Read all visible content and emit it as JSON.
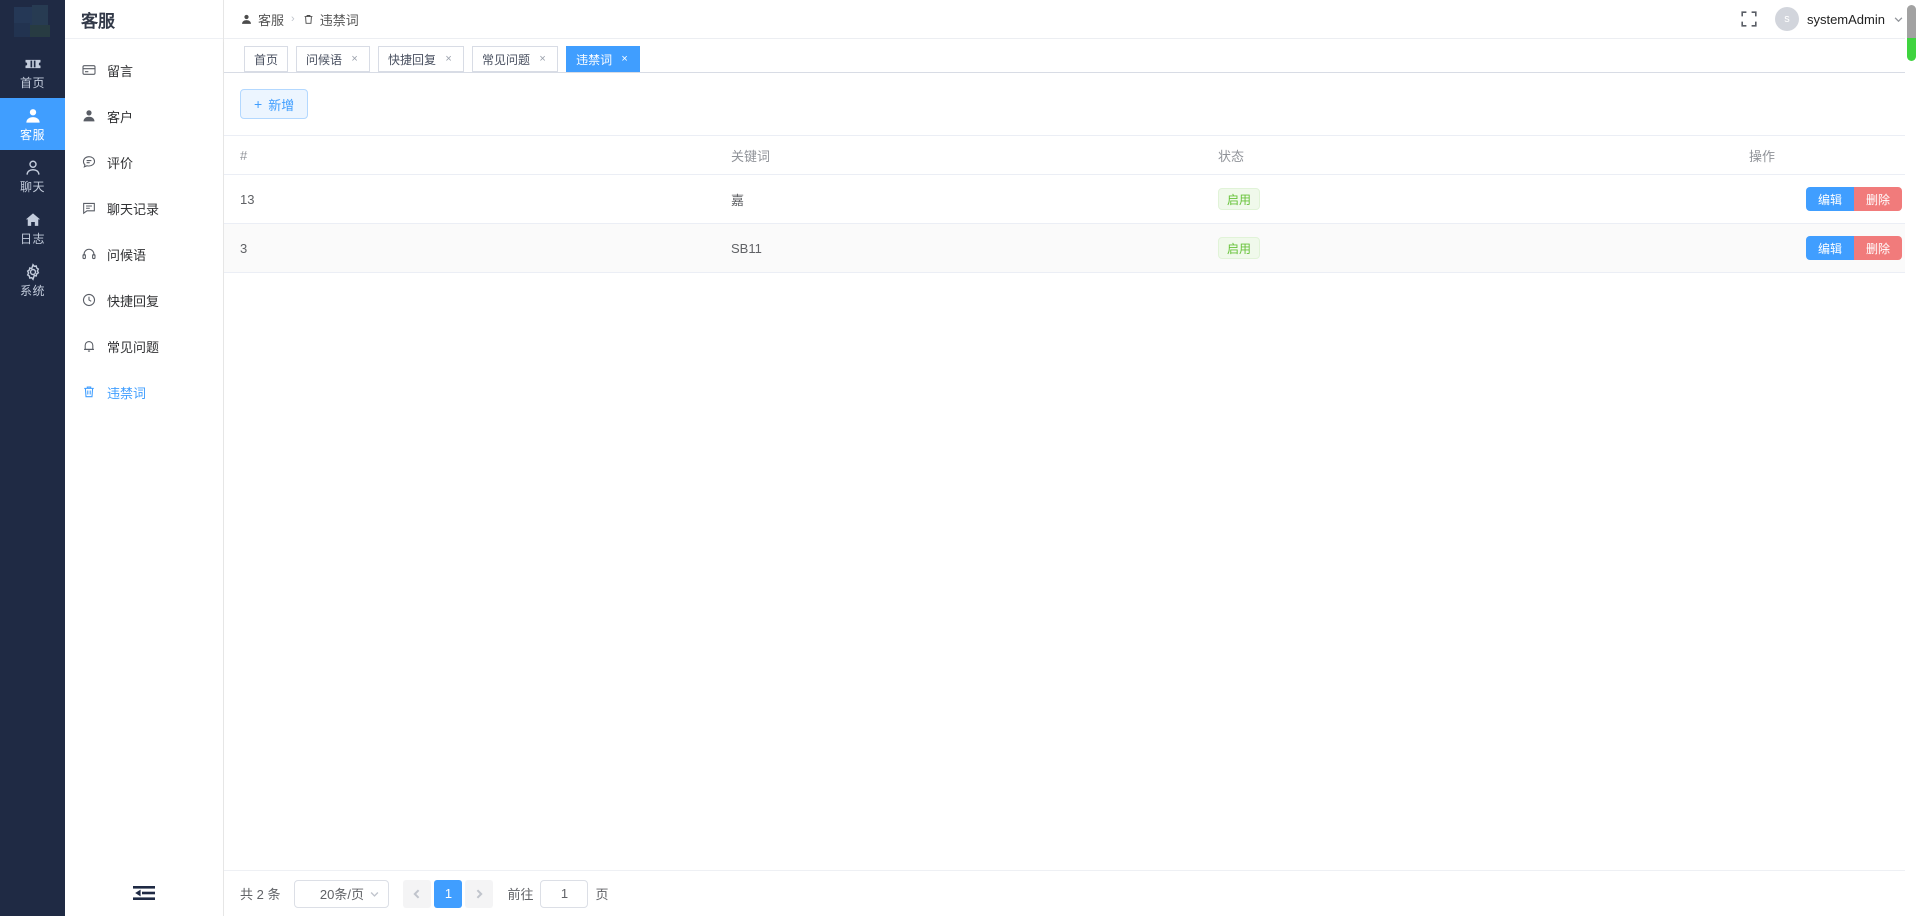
{
  "rail": {
    "logo_icon": "app-logo",
    "items": [
      {
        "label": "首页",
        "icon": "ticket-icon",
        "active": false
      },
      {
        "label": "客服",
        "icon": "user-solid-icon",
        "active": true
      },
      {
        "label": "聊天",
        "icon": "user-outline-icon",
        "active": false
      },
      {
        "label": "日志",
        "icon": "home-icon",
        "active": false
      },
      {
        "label": "系统",
        "icon": "gear-icon",
        "active": false
      }
    ]
  },
  "submenu": {
    "title": "客服",
    "items": [
      {
        "label": "留言",
        "icon": "card-icon",
        "active": false
      },
      {
        "label": "客户",
        "icon": "user-solid-icon",
        "active": false
      },
      {
        "label": "评价",
        "icon": "comment-dots-icon",
        "active": false
      },
      {
        "label": "聊天记录",
        "icon": "chat-lines-icon",
        "active": false
      },
      {
        "label": "问候语",
        "icon": "headset-icon",
        "active": false
      },
      {
        "label": "快捷回复",
        "icon": "clock-icon",
        "active": false
      },
      {
        "label": "常见问题",
        "icon": "bell-icon",
        "active": false
      },
      {
        "label": "违禁词",
        "icon": "trash-icon",
        "active": true
      }
    ],
    "collapse_icon": "hamburger-collapse-icon"
  },
  "navbar": {
    "breadcrumb": [
      {
        "label": "客服",
        "icon": "user-solid-icon"
      },
      {
        "label": "违禁词",
        "icon": "trash-icon"
      }
    ],
    "separator": "›",
    "fullscreen_icon": "fullscreen-icon",
    "user": {
      "avatar_initial": "s",
      "name": "systemAdmin",
      "caret_icon": "chevron-down-icon"
    }
  },
  "tags": [
    {
      "label": "首页",
      "closable": false,
      "active": false
    },
    {
      "label": "问候语",
      "closable": true,
      "active": false
    },
    {
      "label": "快捷回复",
      "closable": true,
      "active": false
    },
    {
      "label": "常见问题",
      "closable": true,
      "active": false
    },
    {
      "label": "违禁词",
      "closable": true,
      "active": true
    }
  ],
  "tag_close_glyph": "×",
  "toolbar": {
    "add_label": "新增",
    "add_plus": "+"
  },
  "table": {
    "columns": [
      {
        "key": "id",
        "label": "#"
      },
      {
        "key": "keyword",
        "label": "关键词"
      },
      {
        "key": "status",
        "label": "状态"
      },
      {
        "key": "ops",
        "label": "操作"
      }
    ],
    "rows": [
      {
        "id": "13",
        "keyword": "嘉",
        "status": "启用",
        "edit_label": "编辑",
        "delete_label": "删除"
      },
      {
        "id": "3",
        "keyword": "SB11",
        "status": "启用",
        "edit_label": "编辑",
        "delete_label": "删除"
      }
    ]
  },
  "pagination": {
    "total_text": "共 2 条",
    "page_size_value": "20条/页",
    "prev_icon": "chevron-left-icon",
    "next_icon": "chevron-right-icon",
    "current_page": "1",
    "jump_prefix": "前往",
    "jump_value": "1",
    "jump_suffix": "页"
  },
  "colors": {
    "rail_bg": "#1f2a44",
    "accent": "#409eff",
    "success": "#67c23a",
    "danger": "#f17b7b",
    "scroll_green": "#3fd43f"
  }
}
